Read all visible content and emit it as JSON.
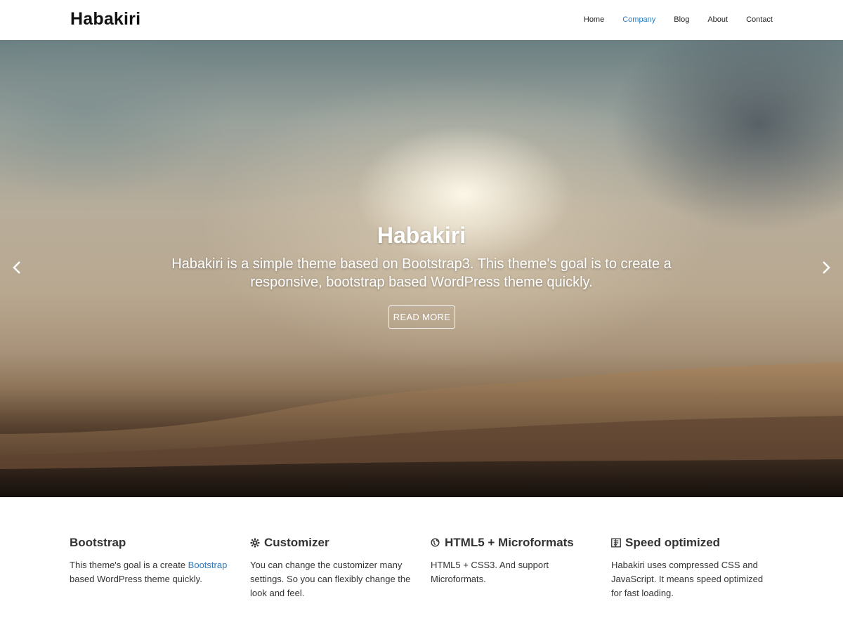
{
  "header": {
    "logo": "Habakiri",
    "nav": [
      {
        "label": "Home",
        "active": false
      },
      {
        "label": "Company",
        "active": true
      },
      {
        "label": "Blog",
        "active": false
      },
      {
        "label": "About",
        "active": false
      },
      {
        "label": "Contact",
        "active": false
      }
    ]
  },
  "hero": {
    "title": "Habakiri",
    "text": "Habakiri is a simple theme based on Bootstrap3. This theme's goal is to create a responsive, bootstrap based WordPress theme quickly.",
    "button_label": "READ MORE",
    "prev_icon": "chevron-left-icon",
    "next_icon": "chevron-right-icon"
  },
  "features": [
    {
      "title": "Bootstrap",
      "icon": "",
      "text_before_link": "This theme's goal is a create ",
      "link_text": "Bootstrap",
      "text_after_link": " based WordPress theme quickly."
    },
    {
      "title": "Customizer",
      "icon": "gear-icon",
      "text": "You can change the customizer many settings. So you can flexibly change the look and feel."
    },
    {
      "title": "HTML5 + Microformats",
      "icon": "globe-icon",
      "text": "HTML5 + CSS3. And support Microformats."
    },
    {
      "title": "Speed optimized",
      "icon": "dashboard-icon",
      "text": "Habakiri uses compressed CSS and JavaScript. It means speed optimized for fast loading."
    }
  ],
  "colors": {
    "accent": "#2a7bc0",
    "text": "#333333"
  }
}
